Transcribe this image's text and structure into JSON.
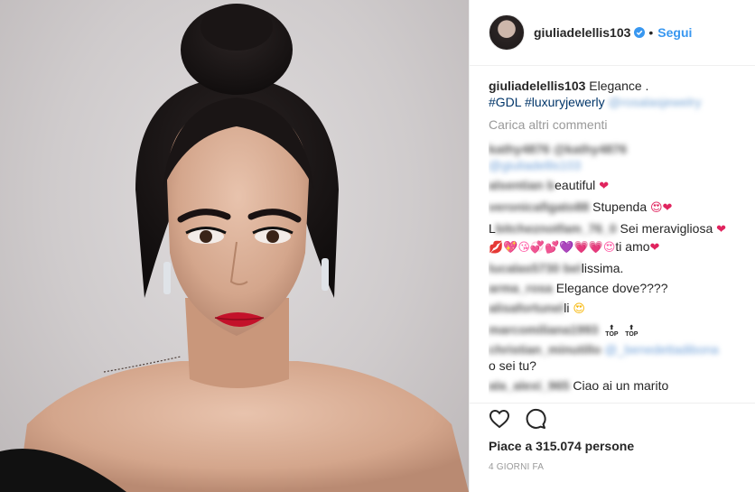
{
  "header": {
    "username": "giuliadelellis103",
    "separator": "•",
    "follow_label": "Segui"
  },
  "caption": {
    "username": "giuliadelellis103",
    "text": "Elegance .",
    "tags": "#GDL #luxuryjewerly",
    "tagged_blurred": "@rosalasjewelry"
  },
  "load_more": "Carica altri commenti",
  "comments": [
    {
      "user_blurred": "kathy4876 @kathy4876",
      "text_blurred": "@giuliadellis103",
      "text": ""
    },
    {
      "user_blurred": "alsentian b",
      "text": "eautiful",
      "emoji": "❤"
    },
    {
      "user_blurred": "veronicafigato88",
      "text": "Stupenda",
      "emoji": "😍❤"
    },
    {
      "user_blurred": "bitcheznotfam_76_0",
      "prefix": "L",
      "text": "Sei meravigliosa",
      "emoji": "❤",
      "line2_emoji": "💋💖😘💞💕💜💗💗😍",
      "line2_text": "ti amo",
      "line2_end": "❤"
    },
    {
      "user_blurred": "lucalas5730 bel",
      "text": "lissima."
    },
    {
      "user_blurred": "arma_rosa",
      "text": "Elegance dove????"
    },
    {
      "user_blurred": "alisafortunel",
      "text": "li",
      "emoji": "😍"
    },
    {
      "user_blurred": "marcomiliana1993",
      "top1": "TOP",
      "top2": "TOP"
    },
    {
      "user_blurred": "christian_minutillo",
      "text_blurred": "@_benedettadibona",
      "line2_text": "o sei tu?"
    },
    {
      "user_blurred": "ala_alexi_965",
      "text": "Ciao ai un marito"
    }
  ],
  "likes_text": "Piace a 315.074 persone",
  "date_text": "4 GIORNI FA",
  "icons": {
    "like": "heart-icon",
    "comment": "comment-icon",
    "verified": "verified-badge-icon"
  },
  "colors": {
    "link_blue": "#3897f0",
    "hashtag": "#003569",
    "muted": "#999999",
    "verified": "#3897f0"
  }
}
